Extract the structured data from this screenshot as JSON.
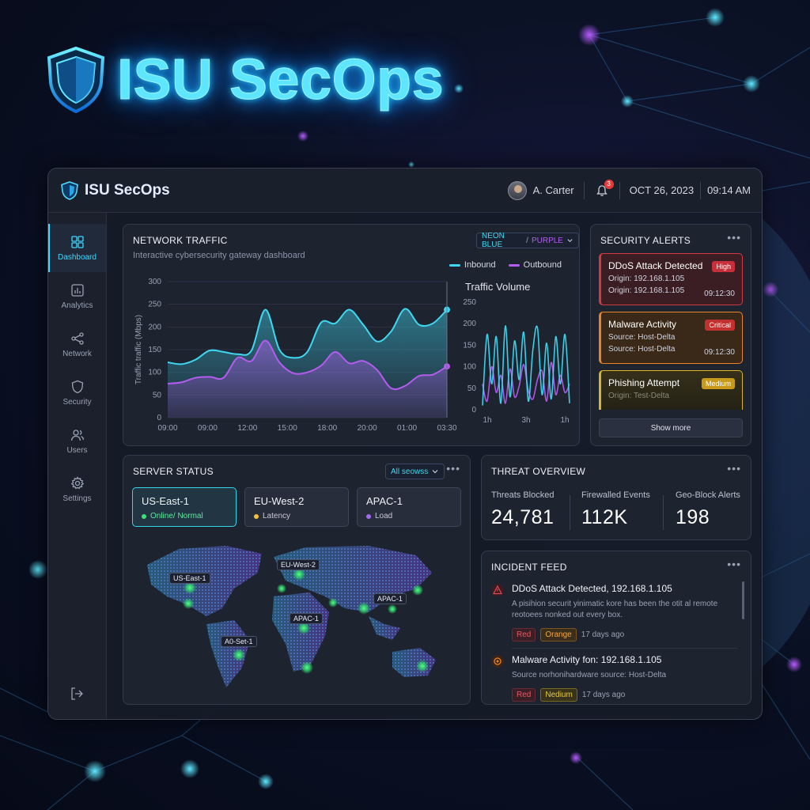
{
  "hero": {
    "title": "ISU SecOps"
  },
  "app": {
    "brand": "ISU SecOps",
    "user": "A. Carter",
    "notification_count": "3",
    "date": "OCT 26, 2023",
    "time": "09:14 AM"
  },
  "sidebar": {
    "items": [
      {
        "label": "Dashboard",
        "icon": "dashboard-icon",
        "active": true
      },
      {
        "label": "Analytics",
        "icon": "analytics-icon"
      },
      {
        "label": "Network",
        "icon": "network-icon"
      },
      {
        "label": "Security",
        "icon": "shield-icon"
      },
      {
        "label": "Users",
        "icon": "users-icon"
      },
      {
        "label": "Settings",
        "icon": "gear-icon"
      }
    ]
  },
  "network": {
    "title": "NETWORK TRAFFIC",
    "subtitle": "Interactive cybersecurity gateway dashboard",
    "theme_select": {
      "part1": "NEON BLUE",
      "sep": "/",
      "part2": "PURPLE"
    },
    "legend": {
      "inbound": "Inbound",
      "outbound": "Outbound"
    },
    "volume_title": "Traffic Volume",
    "colors": {
      "inbound": "#3fd8f0",
      "outbound": "#b45cf0"
    }
  },
  "chart_data": [
    {
      "type": "area",
      "ylabel": "Traffic traffic (Mbps)",
      "ylim": [
        0,
        300
      ],
      "yticks": [
        "300",
        "250",
        "200",
        "150",
        "100",
        "50",
        "0"
      ],
      "xticks": [
        "09:00",
        "09:00",
        "12:00",
        "15:00",
        "18:00",
        "20:00",
        "01:00",
        "03:30"
      ],
      "x": [
        0,
        0.05,
        0.1,
        0.15,
        0.2,
        0.25,
        0.3,
        0.35,
        0.4,
        0.45,
        0.5,
        0.55,
        0.6,
        0.65,
        0.7,
        0.75,
        0.8,
        0.85,
        0.9,
        0.95,
        1.0
      ],
      "series": [
        {
          "name": "Inbound",
          "values": [
            122,
            118,
            128,
            148,
            145,
            140,
            148,
            238,
            150,
            132,
            145,
            210,
            208,
            238,
            205,
            168,
            190,
            240,
            205,
            208,
            238
          ]
        },
        {
          "name": "Outbound",
          "values": [
            75,
            78,
            88,
            90,
            88,
            132,
            125,
            170,
            122,
            98,
            100,
            115,
            145,
            120,
            125,
            105,
            65,
            70,
            92,
            95,
            113
          ]
        }
      ]
    },
    {
      "type": "line",
      "title": "Traffic Volume",
      "ylim": [
        0,
        250
      ],
      "yticks": [
        "250",
        "200",
        "150",
        "100",
        "50",
        "0"
      ],
      "xticks": [
        "1h",
        "3h",
        "1h"
      ],
      "series": [
        {
          "name": "Inbound",
          "values": [
            10,
            175,
            60,
            170,
            15,
            195,
            30,
            160,
            70,
            180,
            20,
            140,
            190,
            35,
            155,
            25,
            170,
            60,
            175,
            15
          ]
        },
        {
          "name": "Outbound",
          "values": [
            60,
            20,
            100,
            40,
            80,
            15,
            95,
            30,
            55,
            105,
            45,
            25,
            70,
            90,
            20,
            110,
            35,
            80,
            40,
            60
          ]
        }
      ]
    }
  ],
  "alerts": {
    "title": "SECURITY ALERTS",
    "items": [
      {
        "title": "DDoS Attack Detected",
        "severity": "High",
        "line1": "Origin: 192.168.1.105",
        "line2": "Origin: 192.168.1.105",
        "time": "09:12:30",
        "color": "#d23a43",
        "bg": "#3b1d24"
      },
      {
        "title": "Malware Activity",
        "severity": "Critical",
        "line1": "Source: Host-Delta",
        "line2": "Source: Host-Delta",
        "time": "09:12:30",
        "color": "#e8842a",
        "bg": "#3a2818"
      },
      {
        "title": "Phishing Attempt",
        "severity": "Medium",
        "line1": "Origin: Test-Delta",
        "line2": "",
        "time": "",
        "color": "#d9b32b",
        "bg": "#36301a"
      }
    ],
    "show_more": "Show more"
  },
  "server": {
    "title": "SERVER STATUS",
    "filter": "All seowss",
    "regions": [
      {
        "name": "US-East-1",
        "status": "Online/ Normal",
        "dot": "#3ee07a"
      },
      {
        "name": "EU-West-2",
        "status": "Latency",
        "dot": "#f0c23a"
      },
      {
        "name": "APAC-1",
        "status": "Load",
        "dot": "#a467ee"
      }
    ],
    "map_labels": [
      "US-East-1",
      "EU-West-2",
      "APAC-1",
      "APAC-1",
      "A0-Set-1"
    ]
  },
  "threat": {
    "title": "THREAT OVERVIEW",
    "stats": [
      {
        "label": "Threats Blocked",
        "value": "24,781"
      },
      {
        "label": "Firewalled Events",
        "value": "112K"
      },
      {
        "label": "Geo-Block Alerts",
        "value": "198"
      }
    ]
  },
  "incident": {
    "title": "INCIDENT FEED",
    "items": [
      {
        "title": "DDoS Attack Detected, 192.168.1.105",
        "desc1": "A pisihion securit yinimatic kore has been the otit al remote",
        "desc2": "reotoees nonked out every box.",
        "tag1": "Red",
        "tag2": "Orange",
        "age": "17 days ago"
      },
      {
        "title": "Malware Activity fon: 192.168.1.105",
        "desc1": "Source norhonihardware source: Host-Delta",
        "desc2": "",
        "tag1": "Red",
        "tag2": "Nedium",
        "age": "17 days ago"
      }
    ]
  }
}
